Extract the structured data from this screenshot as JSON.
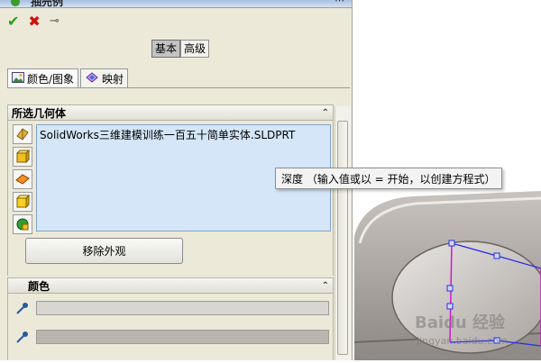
{
  "panel": {
    "title": "抽売例",
    "actions": {
      "ok": "✔",
      "cancel": "✖",
      "pin": "⊸"
    },
    "modes": {
      "basic": "基本",
      "advanced": "高级"
    },
    "tabs": [
      {
        "label": "颜色/图象"
      },
      {
        "label": "映射"
      }
    ],
    "selected_geometry": {
      "header": "所选几何体",
      "items": [
        "SolidWorks三维建模训练一百五十简单实体.SLDPRT"
      ],
      "remove_button": "移除外观"
    },
    "color": {
      "header": "颜色",
      "swatch1": "#d8d6d0",
      "swatch2": "#bab6ae"
    }
  },
  "tooltip": {
    "text": "深度 （输入值或以 = 开始，以创建方程式）"
  },
  "watermark": {
    "brand": "Baidu 经验",
    "url": "jingyan.baidu.com"
  },
  "colors": {
    "sketch": "#2b2be8",
    "edge": "#ce18ce",
    "metal": "#b2aca8"
  }
}
